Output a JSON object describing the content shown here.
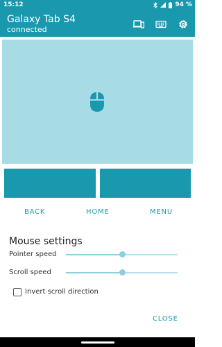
{
  "status_bar": {
    "time": "15:12",
    "battery": "94 %",
    "icons": [
      "bluetooth-icon",
      "signal-icon",
      "battery-icon"
    ]
  },
  "app_bar": {
    "title": "Galaxy Tab S4",
    "subtitle": "connected",
    "icons": [
      "devices-icon",
      "keyboard-icon",
      "gear-icon"
    ],
    "color": "#1a98ad"
  },
  "touchpad": {
    "icon": "mouse-icon",
    "color": "#a7dbe6"
  },
  "nav_buttons": {
    "back": "BACK",
    "home": "HOME",
    "menu": "MENU"
  },
  "mouse_settings": {
    "title": "Mouse settings",
    "pointer_speed": {
      "label": "Pointer speed",
      "value_fraction": 0.5
    },
    "scroll_speed": {
      "label": "Scroll speed",
      "value_fraction": 0.5
    },
    "invert_scroll": {
      "label": "Invert scroll direction",
      "checked": false
    }
  },
  "close_label": "CLOSE"
}
